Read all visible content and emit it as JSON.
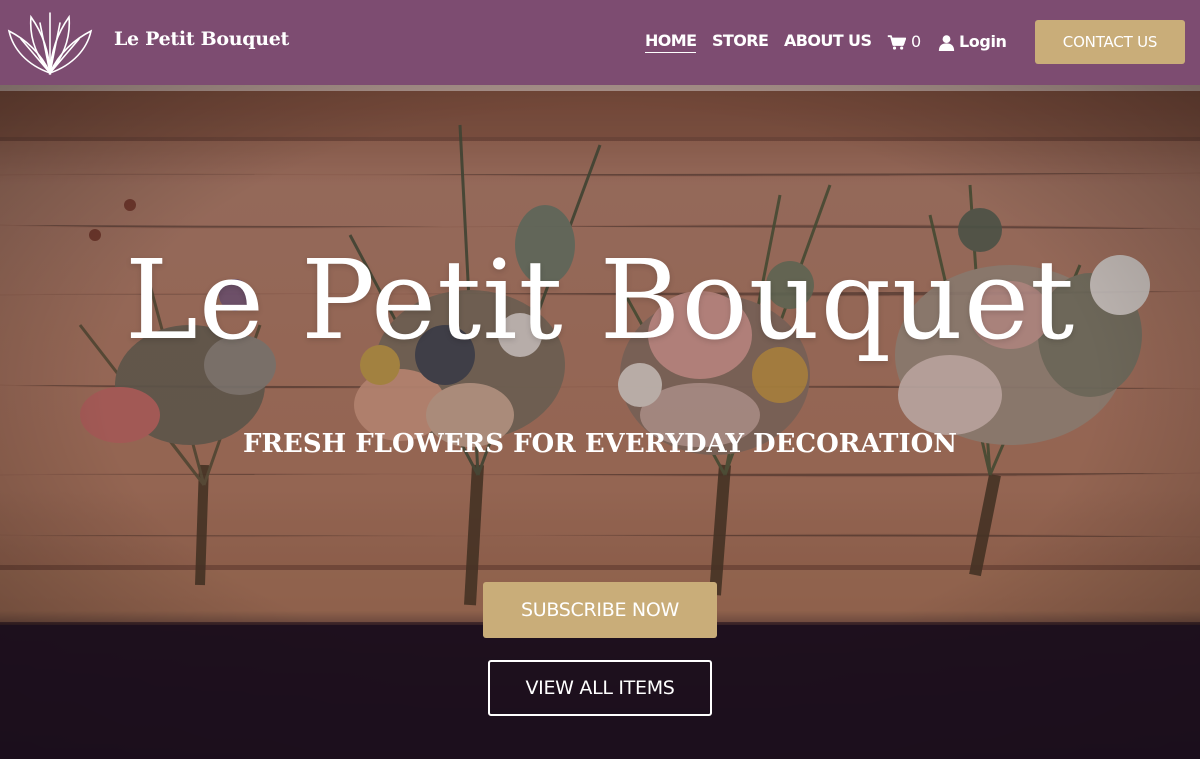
{
  "header": {
    "brand": "Le Petit Bouquet",
    "logo_icon": "lotus-logo-icon",
    "nav": {
      "home": "HOME",
      "store": "STORE",
      "about": "ABOUT US",
      "cart_icon": "cart-icon",
      "cart_count": "0",
      "login_icon": "user-icon",
      "login": "Login"
    },
    "contact_label": "CONTACT US"
  },
  "hero": {
    "title": "Le Petit Bouquet",
    "subtitle": "FRESH FLOWERS FOR EVERYDAY DECORATION",
    "subscribe_label": "SUBSCRIBE NOW",
    "view_all_label": "VIEW ALL ITEMS"
  },
  "colors": {
    "header_bg": "#7d4c71",
    "accent_gold": "#c9ad79",
    "dark_footer": "#1c0f1d",
    "white": "#ffffff"
  }
}
